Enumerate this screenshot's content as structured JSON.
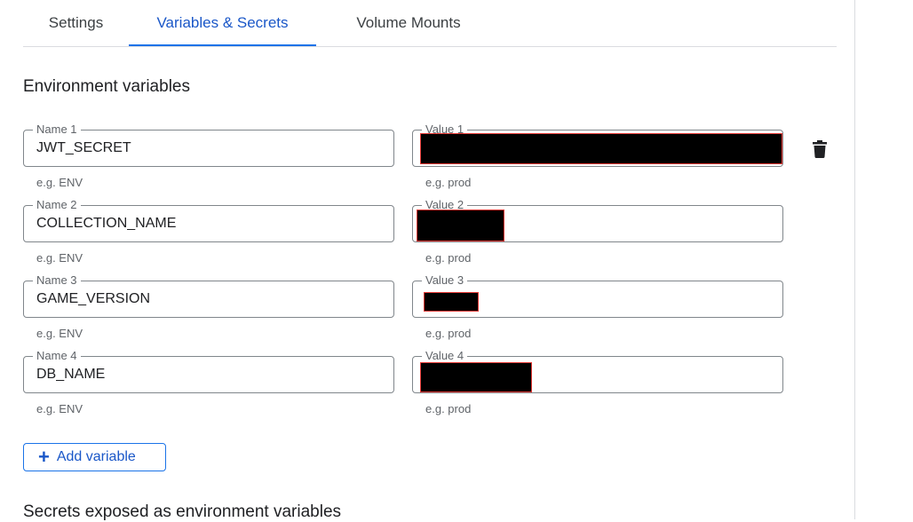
{
  "tabs": [
    {
      "label": "Settings"
    },
    {
      "label": "Variables & Secrets"
    },
    {
      "label": "Volume Mounts"
    }
  ],
  "env_section": {
    "title": "Environment variables",
    "rows": [
      {
        "name_label": "Name 1",
        "name_value": "JWT_SECRET",
        "value_label": "Value 1",
        "name_hint": "e.g. ENV",
        "value_hint": "e.g. prod"
      },
      {
        "name_label": "Name 2",
        "name_value": "COLLECTION_NAME",
        "value_label": "Value 2",
        "name_hint": "e.g. ENV",
        "value_hint": "e.g. prod"
      },
      {
        "name_label": "Name 3",
        "name_value": "GAME_VERSION",
        "value_label": "Value 3",
        "name_hint": "e.g. ENV",
        "value_hint": "e.g. prod"
      },
      {
        "name_label": "Name 4",
        "name_value": "DB_NAME",
        "value_label": "Value 4",
        "name_hint": "e.g. ENV",
        "value_hint": "e.g. prod"
      }
    ],
    "add_button_label": "Add variable",
    "add_icon": "plus-icon",
    "delete_icon": "trash-icon"
  },
  "secrets_section": {
    "title": "Secrets exposed as environment variables"
  },
  "colors": {
    "accent": "#1a73e8",
    "redaction": "#000000",
    "redaction_border": "#e53935"
  }
}
